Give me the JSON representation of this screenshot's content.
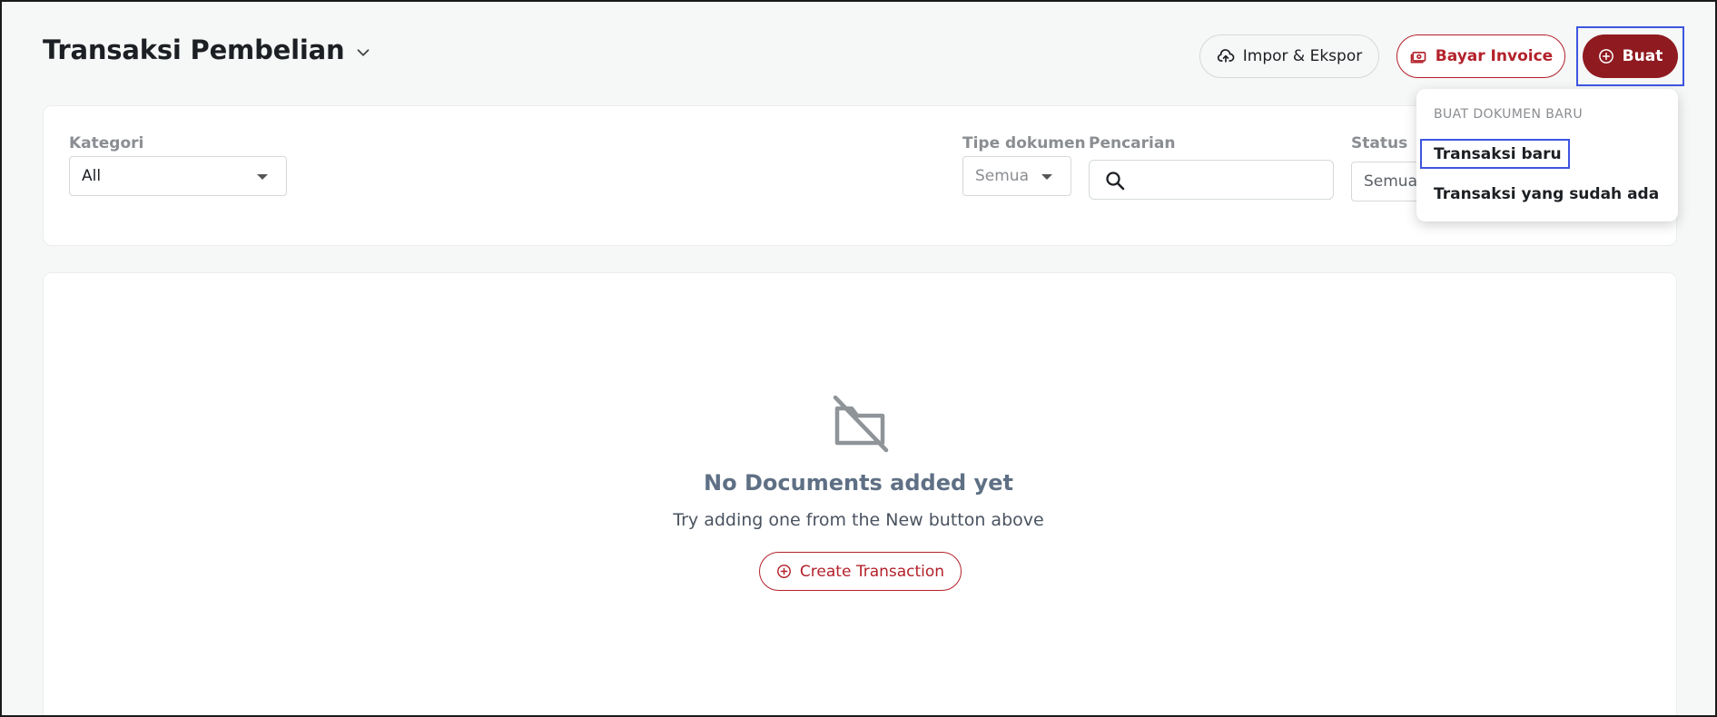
{
  "header": {
    "title": "Transaksi Pembelian",
    "import_export_label": "Impor & Ekspor",
    "pay_invoice_label": "Bayar Invoice",
    "create_label": "Buat"
  },
  "filters": {
    "category_label": "Kategori",
    "category_value": "All",
    "doc_type_label": "Tipe dokumen",
    "doc_type_value": "Semua",
    "search_label": "Pencarian",
    "search_value": "",
    "status_label": "Status",
    "status_value": "Semua"
  },
  "empty_state": {
    "title": "No Documents added yet",
    "subtitle": "Try adding one from the New button above",
    "button_label": "Create Transaction"
  },
  "create_menu": {
    "heading": "BUAT DOKUMEN BARU",
    "items": [
      {
        "label": "Transaksi baru"
      },
      {
        "label": "Transaksi yang sudah ada"
      }
    ]
  },
  "colors": {
    "primary": "#8f1a20",
    "accent_outline": "#b3212b",
    "highlight": "#3d55e0"
  }
}
